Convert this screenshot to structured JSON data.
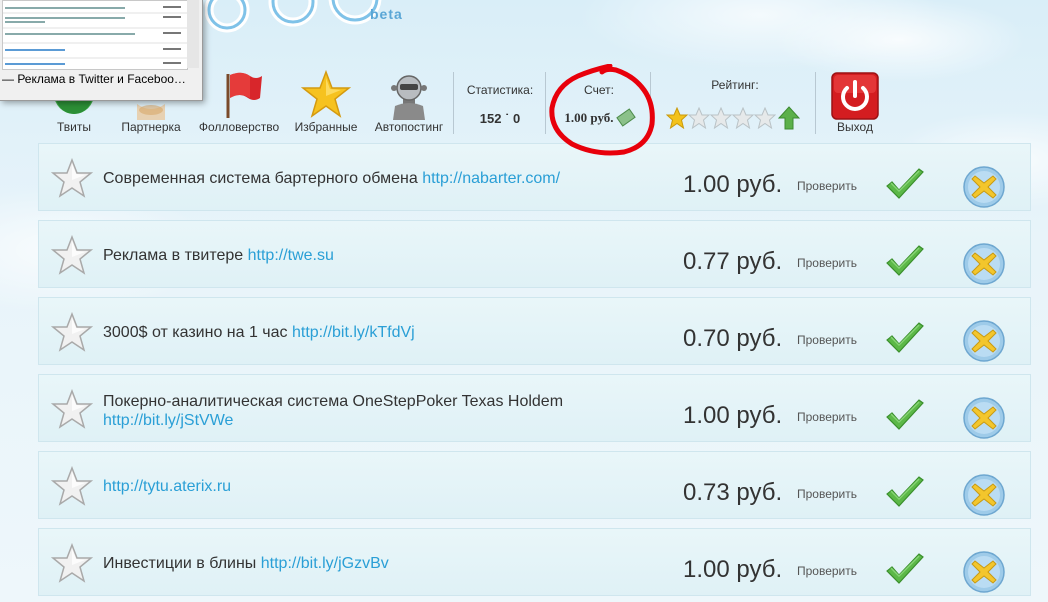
{
  "popup": {
    "caption": "— Реклама в Twitter и Faceboo…"
  },
  "logo": {
    "beta": "beta"
  },
  "toolbar": {
    "tweets": "Твиты",
    "partner": "Партнерка",
    "follow": "Фолловерство",
    "favorites": "Избранные",
    "autopost": "Автопостинг",
    "stats_title": "Статистика:",
    "stats_value": "152 ˙ 0",
    "account_title": "Счет:",
    "account_value": "1.00 руб.",
    "rating_title": "Рейтинг:",
    "rating_value": 1,
    "rating_max": 5,
    "exit": "Выход"
  },
  "colors": {
    "link": "#2a9fd6",
    "exit_red": "#d41d20",
    "annotation": "#e8000b"
  },
  "rows": [
    {
      "title": "Современная система бартерного обмена ",
      "link": "http://nabarter.com/",
      "price": "1.00 руб.",
      "action": "Проверить"
    },
    {
      "title": "Реклама в твитере ",
      "link": "http://twe.su",
      "price": "0.77 руб.",
      "action": "Проверить"
    },
    {
      "title": "3000$ от казино на 1 час ",
      "link": "http://bit.ly/kTfdVj",
      "price": "0.70 руб.",
      "action": "Проверить"
    },
    {
      "title": "Покерно-аналитическая система OneStepPoker Texas Holdem ",
      "link": "http://bit.ly/jStVWe",
      "price": "1.00 руб.",
      "action": "Проверить"
    },
    {
      "title": "",
      "link": "http://tytu.aterix.ru",
      "price": "0.73 руб.",
      "action": "Проверить"
    },
    {
      "title": "Инвестиции в блины ",
      "link": "http://bit.ly/jGzvBv",
      "price": "1.00 руб.",
      "action": "Проверить"
    }
  ]
}
